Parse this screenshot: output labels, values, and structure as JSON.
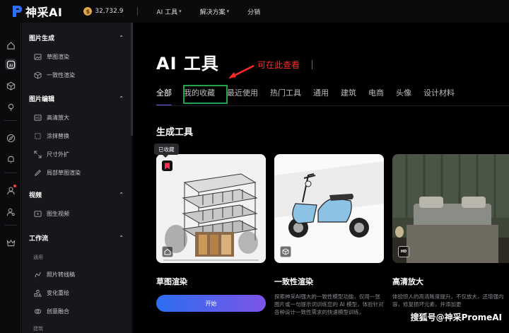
{
  "topbar": {
    "logo_text": "神采AI",
    "credits": "32,732.9",
    "coin_symbol": "$",
    "nav": [
      {
        "label": "AI 工具",
        "caret": true
      },
      {
        "label": "解决方案",
        "caret": true
      },
      {
        "label": "分销",
        "caret": false
      }
    ]
  },
  "sidebar": {
    "sections": [
      {
        "title": "图片生成",
        "chevron": "⌃",
        "items": [
          "草图渲染",
          "一致性渲染"
        ]
      },
      {
        "title": "图片编辑",
        "chevron": "⌃",
        "items": [
          "高清放大",
          "涂抹替换",
          "尺寸外扩",
          "局部草图渲染"
        ]
      },
      {
        "title": "视频",
        "chevron": "⌃",
        "items": [
          "图生视频"
        ]
      },
      {
        "title": "工作流",
        "chevron": "⌃",
        "sub": "通用",
        "items": [
          "照片转线稿",
          "变化重绘",
          "创意融合"
        ],
        "sub2": "建筑"
      }
    ]
  },
  "main": {
    "title": "AI 工具",
    "annotation": "可在此查看",
    "tabs": [
      "全部",
      "我的收藏",
      "最近使用",
      "热门工具",
      "通用",
      "建筑",
      "电商",
      "头像",
      "设计材料"
    ],
    "section_title": "生成工具",
    "tooltip": "已收藏",
    "cards": [
      {
        "title": "草图渲染",
        "desc": "",
        "button": "开始"
      },
      {
        "title": "一致性渲染",
        "desc": "探索神采AI强大的一致性模型功能，仅用一张图片或一句提示词训练您的 AI 模型，体验针对各种设计一致性需求的快速模型训练。"
      },
      {
        "title": "高清放大",
        "desc": "体验惊人的高清晰度提升。不仅放大，还增强内容，修复损坏元素，并添加更"
      }
    ],
    "watermark": "搜狐号@神采PromeAI"
  },
  "colors": {
    "accent": "#6d5cf0",
    "annotation": "#ff2a2a",
    "highlight": "#1ea34a",
    "button_start": "#2c6df0",
    "button_end": "#7d54e8"
  }
}
